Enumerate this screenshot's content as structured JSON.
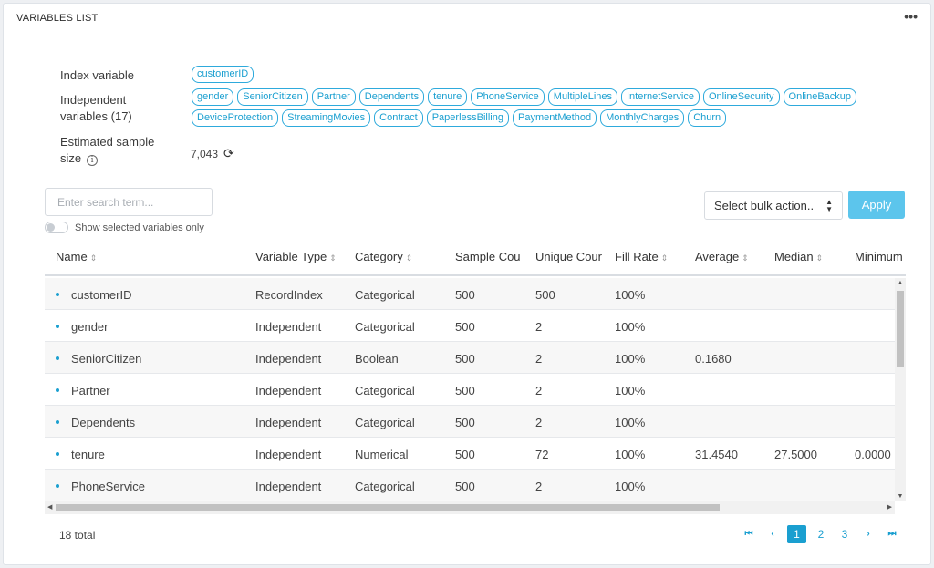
{
  "card": {
    "title": "VARIABLES LIST",
    "menu_icon": "ellipsis-icon",
    "menu_glyph": "•••"
  },
  "meta": {
    "index_label": "Index variable",
    "index_chips": [
      "customerID"
    ],
    "independent_label": "Independent variables (17)",
    "independent_chips": [
      "gender",
      "SeniorCitizen",
      "Partner",
      "Dependents",
      "tenure",
      "PhoneService",
      "MultipleLines",
      "InternetService",
      "OnlineSecurity",
      "OnlineBackup",
      "DeviceProtection",
      "StreamingMovies",
      "Contract",
      "PaperlessBilling",
      "PaymentMethod",
      "MonthlyCharges",
      "Churn"
    ],
    "sample_label": "Estimated sample size",
    "sample_value": "7,043",
    "info_glyph": "i",
    "refresh_glyph": "⟳"
  },
  "controls": {
    "search_placeholder": "Enter search term...",
    "toggle_label": "Show selected variables only",
    "toggle_on": false,
    "bulk_action": "Select bulk action..",
    "apply_label": "Apply"
  },
  "table": {
    "columns": [
      "Name",
      "Variable Type",
      "Category",
      "Sample Cou",
      "Unique Cour",
      "Fill Rate",
      "Average",
      "Median",
      "Minimum"
    ],
    "sortable_glyph": "⇕",
    "rows": [
      [
        "customerID",
        "RecordIndex",
        "Categorical",
        "500",
        "500",
        "100%",
        "",
        "",
        ""
      ],
      [
        "gender",
        "Independent",
        "Categorical",
        "500",
        "2",
        "100%",
        "",
        "",
        ""
      ],
      [
        "SeniorCitizen",
        "Independent",
        "Boolean",
        "500",
        "2",
        "100%",
        "0.1680",
        "",
        ""
      ],
      [
        "Partner",
        "Independent",
        "Categorical",
        "500",
        "2",
        "100%",
        "",
        "",
        ""
      ],
      [
        "Dependents",
        "Independent",
        "Categorical",
        "500",
        "2",
        "100%",
        "",
        "",
        ""
      ],
      [
        "tenure",
        "Independent",
        "Numerical",
        "500",
        "72",
        "100%",
        "31.4540",
        "27.5000",
        "0.0000"
      ],
      [
        "PhoneService",
        "Independent",
        "Categorical",
        "500",
        "2",
        "100%",
        "",
        "",
        ""
      ]
    ]
  },
  "footer": {
    "total": "18 total",
    "pages": [
      "1",
      "2",
      "3"
    ],
    "current_page": "1",
    "first_glyph": "⏮",
    "prev_glyph": "‹",
    "next_glyph": "›",
    "last_glyph": "⏭"
  },
  "colors": {
    "accent": "#1a9fd0",
    "apply_bg": "#5cc5ec"
  }
}
